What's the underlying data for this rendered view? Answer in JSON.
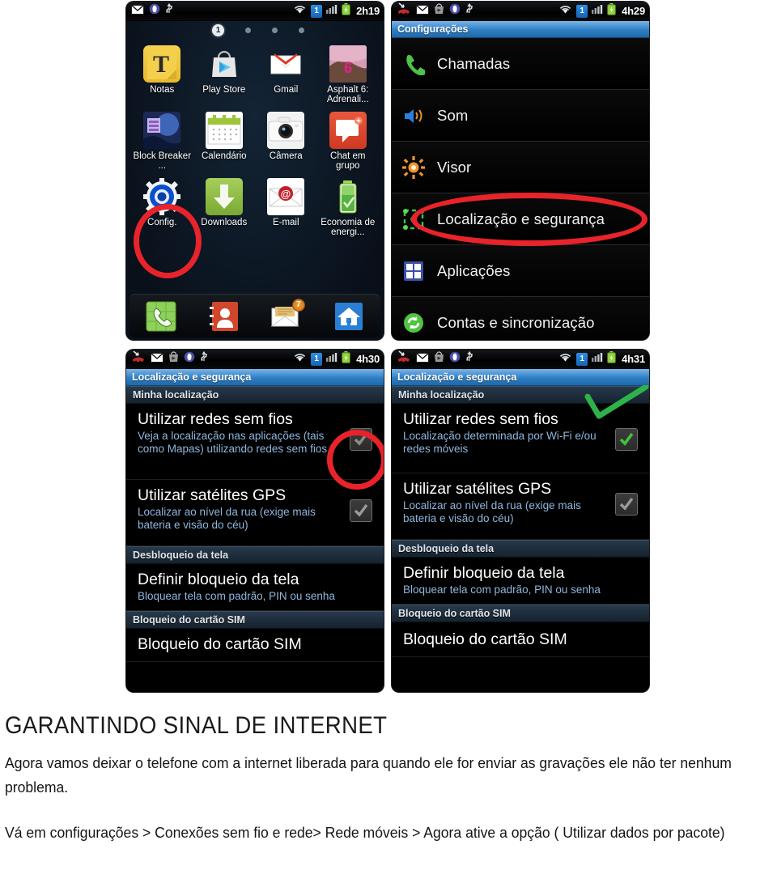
{
  "document": {
    "heading": "GARANTINDO SINAL DE INTERNET",
    "paragraph1": "Agora vamos deixar o telefone com a internet liberada para quando ele for enviar as gravações ele não ter nenhum problema.",
    "paragraph2": "Vá em configurações > Conexões sem fio e rede> Rede móveis > Agora ative a opção ( Utilizar dados por pacote)"
  },
  "colors": {
    "annotation_red": "#e8232a",
    "annotation_green": "#2eb34a",
    "titlebar_blue": "#2e7fc4",
    "link_blue": "#8fb6dd"
  },
  "phone1": {
    "statusbar": {
      "icons": [
        "message-icon",
        "opera-icon",
        "usb-icon",
        "wifi-icon",
        "sim-1-icon",
        "signal-icon",
        "battery-icon"
      ],
      "sim_label": "1",
      "clock": "2h19"
    },
    "page_indicator": {
      "current": "1",
      "total": 4
    },
    "apps": [
      {
        "label": "Notas",
        "icon": "notes-icon"
      },
      {
        "label": "Play Store",
        "icon": "play-store-icon"
      },
      {
        "label": "Gmail",
        "icon": "gmail-icon"
      },
      {
        "label": "Asphalt 6: Adrenali...",
        "icon": "asphalt-game-icon"
      },
      {
        "label": "Block Breaker ...",
        "icon": "block-breaker-icon"
      },
      {
        "label": "Calendário",
        "icon": "calendar-icon"
      },
      {
        "label": "Câmera",
        "icon": "camera-icon"
      },
      {
        "label": "Chat em grupo",
        "icon": "group-chat-icon"
      },
      {
        "label": "Config.",
        "icon": "settings-gear-icon"
      },
      {
        "label": "Downloads",
        "icon": "downloads-icon"
      },
      {
        "label": "E-mail",
        "icon": "email-icon"
      },
      {
        "label": "Economia de energi...",
        "icon": "power-saving-icon"
      }
    ],
    "dock": [
      {
        "icon": "phone-dialer-icon",
        "badge": ""
      },
      {
        "icon": "contacts-icon",
        "badge": ""
      },
      {
        "icon": "messages-icon",
        "badge": "7"
      },
      {
        "icon": "home-icon",
        "badge": ""
      }
    ],
    "annotation": {
      "type": "red-ellipse",
      "target_label": "Config."
    }
  },
  "phone2": {
    "statusbar": {
      "icons": [
        "missed-call-icon",
        "message-icon",
        "play-store-icon",
        "opera-icon",
        "usb-icon",
        "wifi-icon",
        "sim-1-icon",
        "signal-icon",
        "battery-icon"
      ],
      "sim_label": "1",
      "clock": "4h29"
    },
    "title": "Configurações",
    "rows": [
      {
        "label": "Chamadas",
        "icon": "call-icon"
      },
      {
        "label": "Som",
        "icon": "sound-icon"
      },
      {
        "label": "Visor",
        "icon": "display-icon"
      },
      {
        "label": "Localização e segurança",
        "icon": "location-security-icon"
      },
      {
        "label": "Aplicações",
        "icon": "applications-icon"
      },
      {
        "label": "Contas e sincronização",
        "icon": "sync-icon"
      }
    ],
    "annotation": {
      "type": "red-ellipse",
      "target_label": "Localização e segurança"
    }
  },
  "phone3": {
    "statusbar": {
      "icons": [
        "missed-call-icon",
        "message-icon",
        "play-store-icon",
        "opera-icon",
        "usb-icon",
        "wifi-icon",
        "sim-1-icon",
        "signal-icon",
        "battery-icon"
      ],
      "sim_label": "1",
      "clock": "4h30"
    },
    "title": "Localização e segurança",
    "section1": "Minha localização",
    "option1": {
      "title": "Utilizar redes sem fios",
      "desc": "Veja a localização nas aplicações (tais como Mapas) utilizando redes sem fios",
      "checked": false
    },
    "option2": {
      "title": "Utilizar satélites GPS",
      "desc": "Localizar ao nível da rua (exige mais bateria e visão do céu)",
      "checked": false
    },
    "section2": "Desbloqueio da tela",
    "option3": {
      "title": "Definir bloqueio da tela",
      "desc": "Bloquear tela com padrão, PIN ou senha"
    },
    "section3": "Bloqueio do cartão SIM",
    "option4": {
      "title": "Bloqueio do cartão SIM"
    },
    "annotation": {
      "type": "red-circle",
      "target": "checkbox-utilizar-redes-sem-fios"
    }
  },
  "phone4": {
    "statusbar": {
      "icons": [
        "missed-call-icon",
        "message-icon",
        "play-store-icon",
        "opera-icon",
        "usb-icon",
        "wifi-icon",
        "sim-1-icon",
        "signal-icon",
        "battery-icon"
      ],
      "sim_label": "1",
      "clock": "4h31"
    },
    "title": "Localização e segurança",
    "section1": "Minha localização",
    "option1": {
      "title": "Utilizar redes sem fios",
      "desc": "Localização determinada por Wi-Fi e/ou redes móveis",
      "checked": true
    },
    "option2": {
      "title": "Utilizar satélites GPS",
      "desc": "Localizar ao nível da rua (exige mais bateria e visão do céu)",
      "checked": false
    },
    "section2": "Desbloqueio da tela",
    "option3": {
      "title": "Definir bloqueio da tela",
      "desc": "Bloquear tela com padrão, PIN ou senha"
    },
    "section3": "Bloqueio do cartão SIM",
    "option4": {
      "title": "Bloqueio do cartão SIM"
    },
    "annotation": {
      "type": "green-check-mark",
      "target": "checkbox-utilizar-redes-sem-fios"
    }
  }
}
